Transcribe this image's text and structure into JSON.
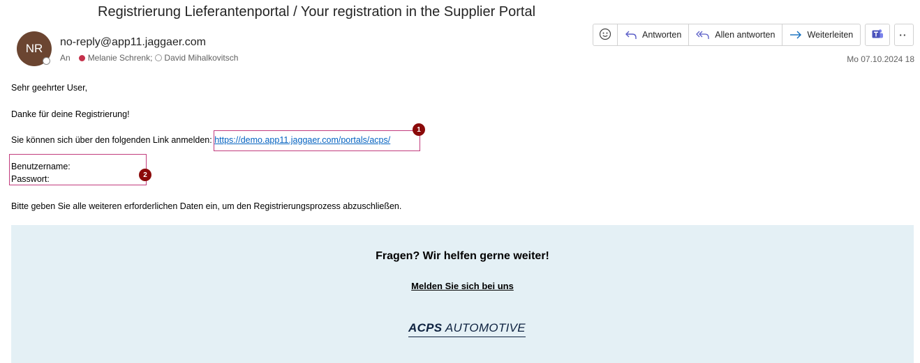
{
  "email": {
    "subject": "Registrierung Lieferantenportal / Your registration in the Supplier Portal",
    "sender": {
      "initials": "NR",
      "address": "no-reply@app11.jaggaer.com",
      "avatar_color": "#6b4531"
    },
    "recipients": {
      "prefix": "An",
      "items": [
        {
          "name": "Melanie Schrenk;",
          "status": "busy"
        },
        {
          "name": "David Mihalkovitsch",
          "status": "offline"
        }
      ]
    },
    "date": "Mo 07.10.2024 18"
  },
  "toolbar": {
    "emoji_icon": "smiley-icon",
    "reply_label": "Antworten",
    "reply_all_label": "Allen antworten",
    "forward_label": "Weiterleiten",
    "teams_icon": "teams-icon",
    "more_icon": "more-icon"
  },
  "body": {
    "greeting": "Sehr geehrter User,",
    "thanks": "Danke für deine Registrierung!",
    "link_intro": "Sie können sich über den folgenden Link anmelden:",
    "link_text": "https://demo.app11.jaggaer.com/portals/acps/",
    "username_label": "Benutzername:",
    "password_label": "Passwort:",
    "instructions": "Bitte geben Sie alle weiteren erforderlichen Daten ein, um den Registrierungsprozess abzuschließen."
  },
  "annotations": {
    "badge1": "1",
    "badge2": "2",
    "highlight_color": "#c23b7d",
    "badge_color": "#8b0a0a"
  },
  "footer": {
    "title": "Fragen? Wir helfen gerne weiter!",
    "contact_link": "Melden Sie sich bei uns",
    "brand_bold": "ACPS",
    "brand_rest": "AUTOMOTIVE",
    "background": "#e4f0f5"
  }
}
